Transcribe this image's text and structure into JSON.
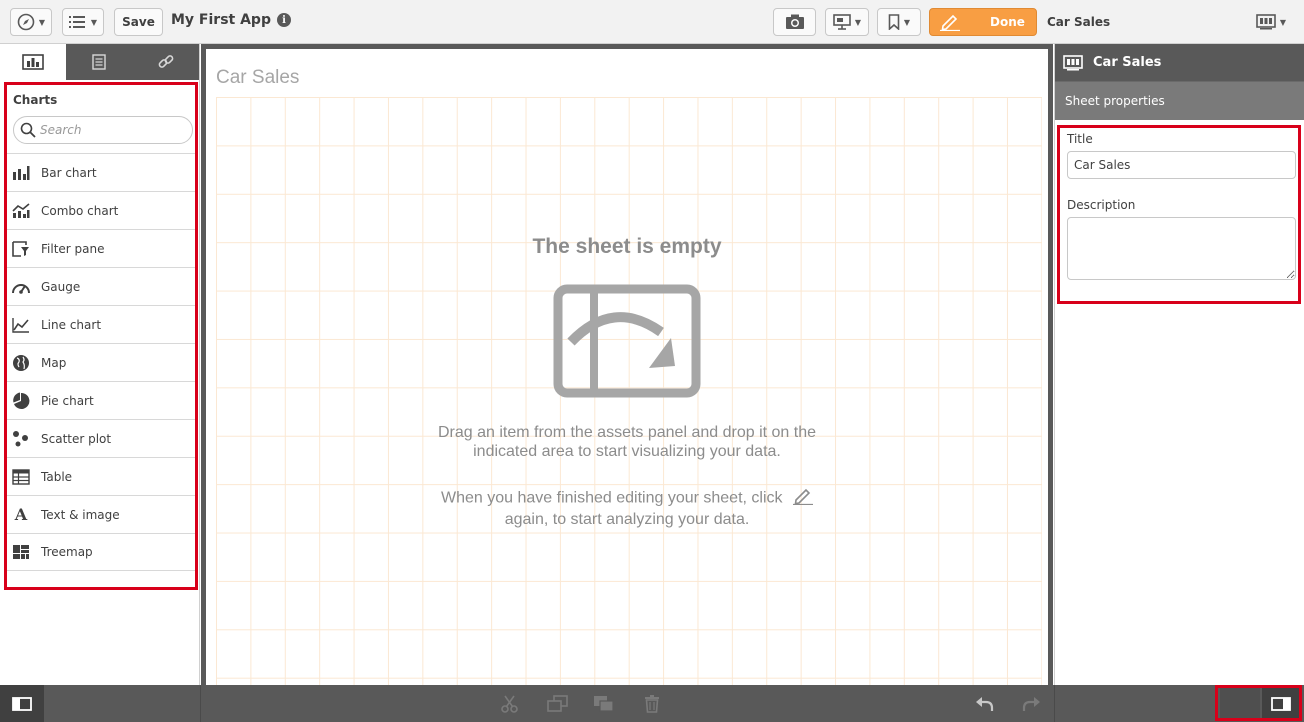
{
  "toolbar": {
    "save_label": "Save",
    "app_title": "My First App",
    "done_label": "Done",
    "current_sheet": "Car Sales"
  },
  "left_panel": {
    "tabs": [
      "charts-tab",
      "fields-tab",
      "master-items-tab"
    ],
    "heading": "Charts",
    "search_placeholder": "Search",
    "items": [
      {
        "label": "Bar chart",
        "icon": "bar-chart-icon"
      },
      {
        "label": "Combo chart",
        "icon": "combo-chart-icon"
      },
      {
        "label": "Filter pane",
        "icon": "filter-pane-icon"
      },
      {
        "label": "Gauge",
        "icon": "gauge-icon"
      },
      {
        "label": "Line chart",
        "icon": "line-chart-icon"
      },
      {
        "label": "Map",
        "icon": "map-icon"
      },
      {
        "label": "Pie chart",
        "icon": "pie-chart-icon"
      },
      {
        "label": "Scatter plot",
        "icon": "scatter-plot-icon"
      },
      {
        "label": "Table",
        "icon": "table-icon"
      },
      {
        "label": "Text & image",
        "icon": "text-image-icon"
      },
      {
        "label": "Treemap",
        "icon": "treemap-icon"
      }
    ]
  },
  "canvas": {
    "title": "Car Sales",
    "empty_title": "The sheet is empty",
    "hint1_line1": "Drag an item from the assets panel and drop it on the",
    "hint1_line2": "indicated area to start visualizing your data.",
    "hint2_line1": "When you have finished editing your sheet, click",
    "hint2_line2": "again, to start analyzing your data."
  },
  "right_panel": {
    "header": "Car Sales",
    "subheader": "Sheet properties",
    "title_label": "Title",
    "title_value": "Car Sales",
    "description_label": "Description",
    "description_value": ""
  },
  "colors": {
    "accent": "#f89e43",
    "panel_dark": "#595959",
    "highlight": "#d8001a",
    "grid": "#fbe8d3"
  }
}
